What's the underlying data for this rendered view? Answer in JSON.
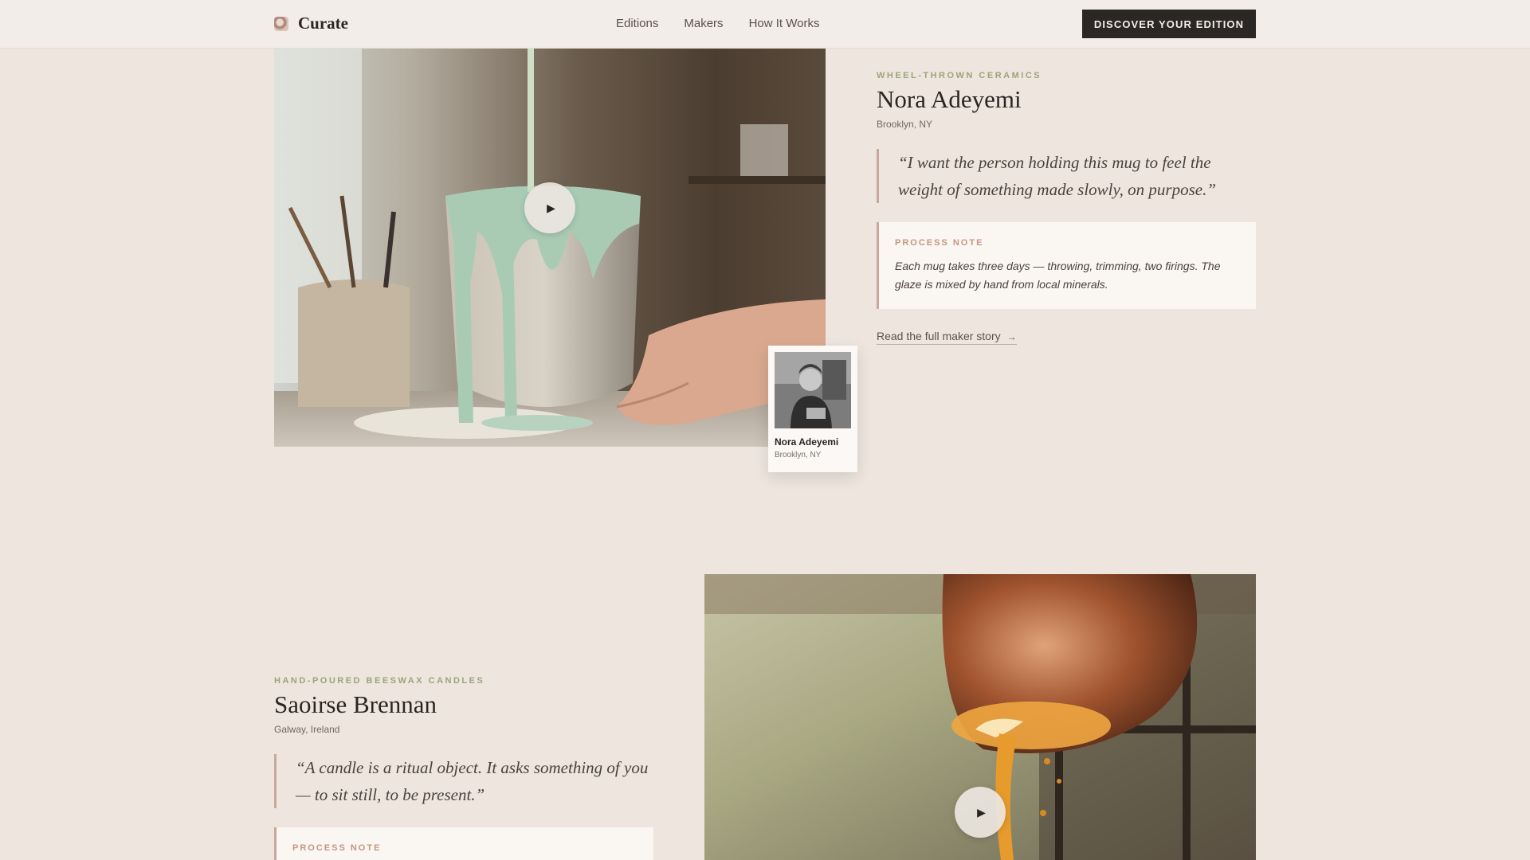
{
  "header": {
    "brand": "Curate",
    "nav": [
      "Editions",
      "Makers",
      "How It Works"
    ],
    "cta": "DISCOVER YOUR EDITION"
  },
  "maker1": {
    "craft": "WHEEL-THROWN CERAMICS",
    "name": "Nora Adeyemi",
    "location": "Brooklyn, NY",
    "quote": "“I want the person holding this mug to feel the weight of something made slowly, on purpose.”",
    "note_label": "PROCESS NOTE",
    "note_text": "Each mug takes three days — throwing, trimming, two firings. The glaze is mixed by hand from local minerals.",
    "story_link": "Read the full maker story",
    "card_name": "Nora Adeyemi",
    "card_location": "Brooklyn, NY"
  },
  "maker2": {
    "craft": "HAND-POURED BEESWAX CANDLES",
    "name": "Saoirse Brennan",
    "location": "Galway, Ireland",
    "quote": "“A candle is a ritual object. It asks something of you — to sit still, to be present.”",
    "note_label": "PROCESS NOTE"
  },
  "icons": {
    "play": "play-icon",
    "arrow": "arrow-right-icon",
    "logo": "brand-logo-icon"
  }
}
